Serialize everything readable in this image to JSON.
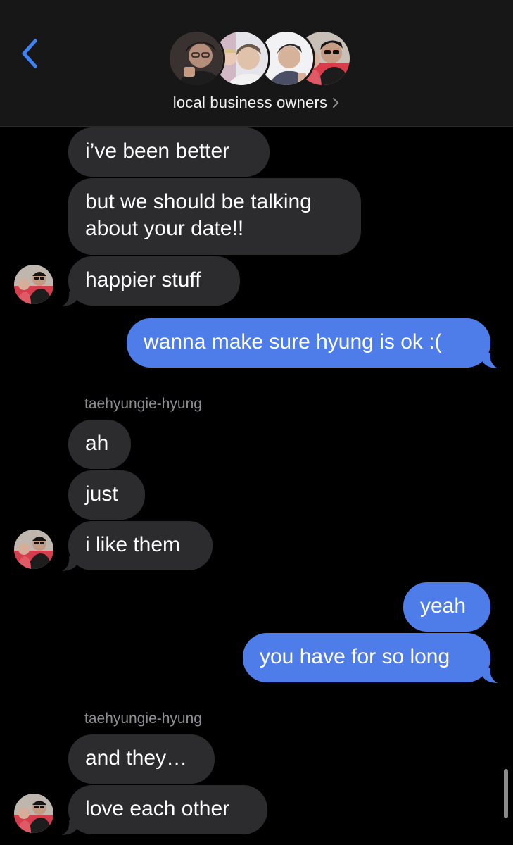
{
  "header": {
    "title": "local business owners",
    "back_icon": "chevron-left-icon",
    "title_icon": "chevron-right-icon"
  },
  "colors": {
    "header_bg": "#171717",
    "incoming_bubble": "#2c2c2e",
    "outgoing_bubble": "#4e7de9",
    "accent": "#3d82f6",
    "sender_label": "#8e8e93"
  },
  "messages": [
    {
      "text": "i’ve been better",
      "direction": "incoming"
    },
    {
      "text": "but we should be talking about your date!!",
      "direction": "incoming"
    },
    {
      "text": "happier stuff",
      "direction": "incoming"
    },
    {
      "text": "wanna make sure hyung is ok :(",
      "direction": "outgoing"
    },
    {
      "sender": "taehyungie-hyung",
      "text": "ah",
      "direction": "incoming"
    },
    {
      "text": "just",
      "direction": "incoming"
    },
    {
      "text": "i like them",
      "direction": "incoming"
    },
    {
      "text": "yeah",
      "direction": "outgoing"
    },
    {
      "text": "you have for so long",
      "direction": "outgoing"
    },
    {
      "sender": "taehyungie-hyung",
      "text": "and they…",
      "direction": "incoming"
    },
    {
      "text": "love each other",
      "direction": "incoming"
    }
  ]
}
